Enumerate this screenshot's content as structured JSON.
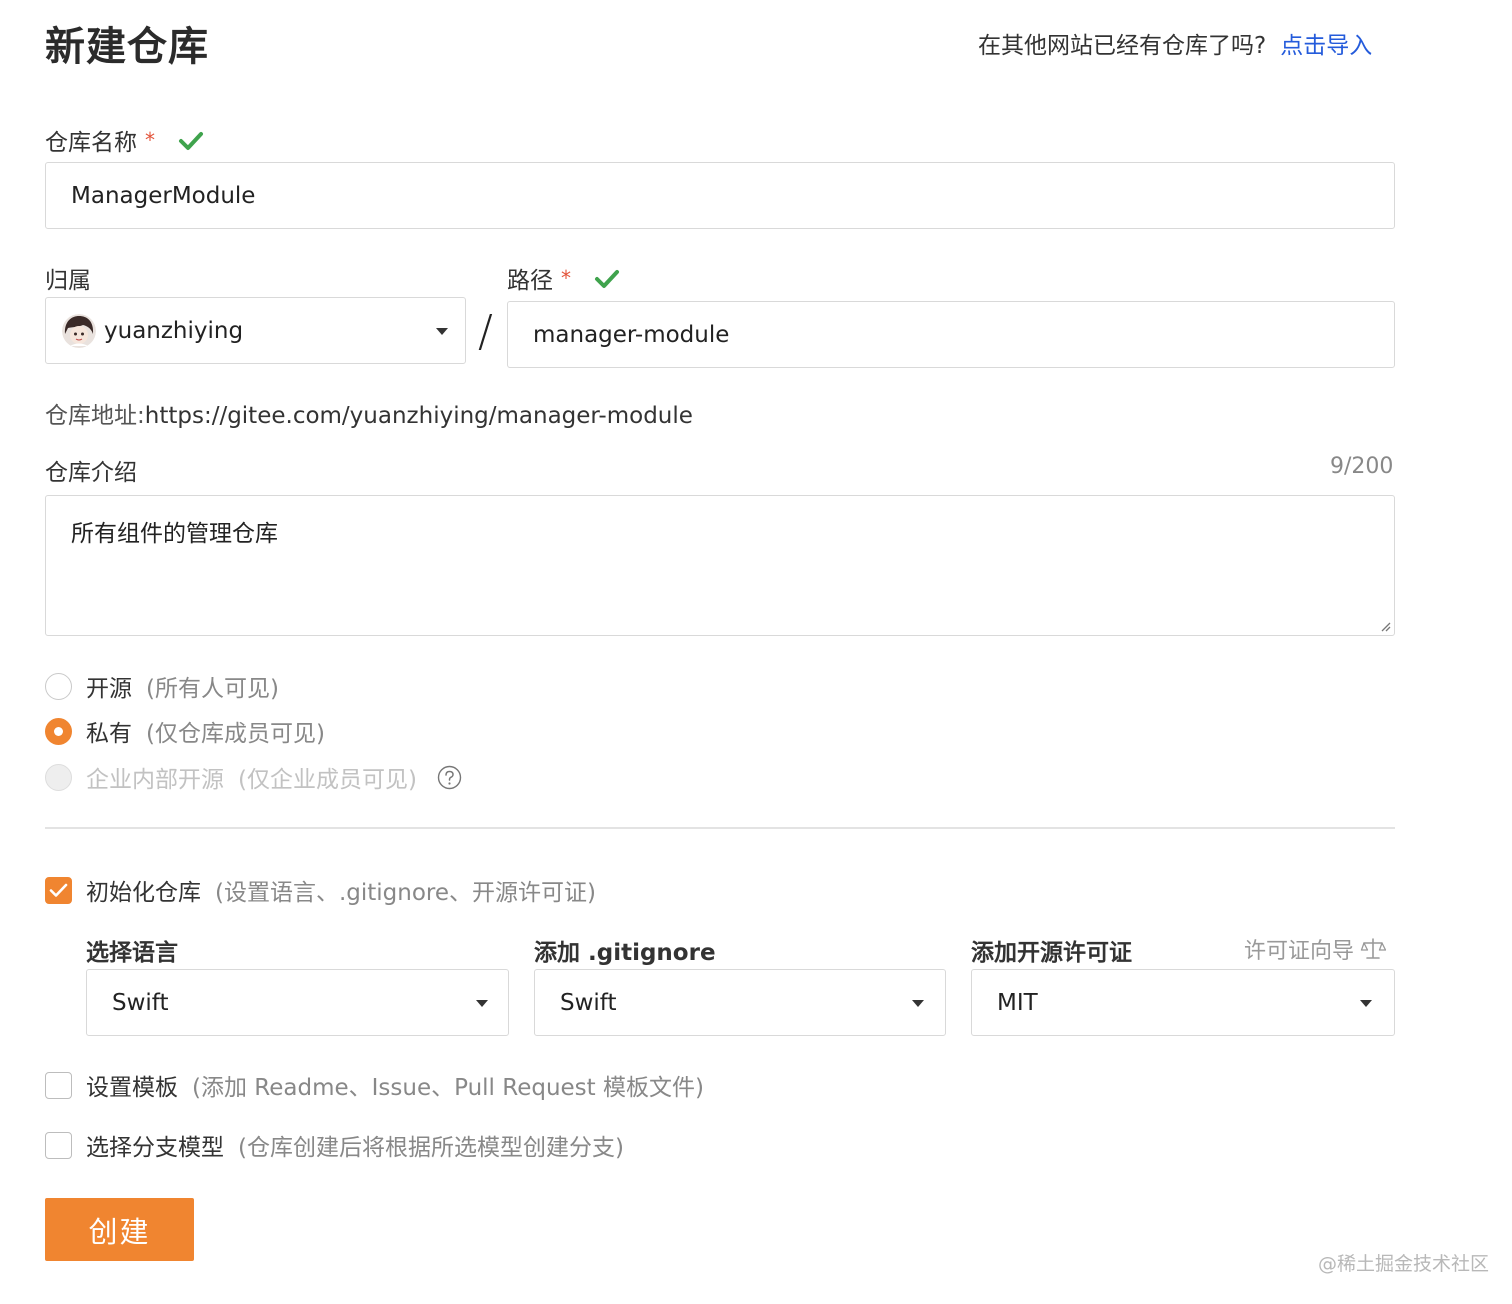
{
  "header": {
    "title": "新建仓库",
    "import_hint": "在其他网站已经有仓库了吗?",
    "import_link": "点击导入"
  },
  "repo_name": {
    "label": "仓库名称",
    "required_mark": "*",
    "value": "ManagerModule"
  },
  "owner": {
    "label": "归属",
    "value": "yuanzhiying"
  },
  "path": {
    "label": "路径",
    "required_mark": "*",
    "separator": "/",
    "value": "manager-module"
  },
  "address": {
    "label": "仓库地址:",
    "url": "https://gitee.com/yuanzhiying/manager-module"
  },
  "description": {
    "label": "仓库介绍",
    "counter": "9/200",
    "value": "所有组件的管理仓库"
  },
  "visibility": {
    "options": [
      {
        "label": "开源",
        "hint": "(所有人可见)",
        "checked": false,
        "disabled": false
      },
      {
        "label": "私有",
        "hint": "(仅仓库成员可见)",
        "checked": true,
        "disabled": false
      },
      {
        "label": "企业内部开源",
        "hint": "(仅企业成员可见)",
        "checked": false,
        "disabled": true
      }
    ]
  },
  "init_repo": {
    "label": "初始化仓库",
    "hint": "(设置语言、.gitignore、开源许可证)",
    "checked": true,
    "language": {
      "label": "选择语言",
      "value": "Swift"
    },
    "gitignore": {
      "label": "添加 .gitignore",
      "value": "Swift"
    },
    "license": {
      "label": "添加开源许可证",
      "guide": "许可证向导",
      "value": "MIT"
    }
  },
  "template": {
    "label": "设置模板",
    "hint": "(添加 Readme、Issue、Pull Request 模板文件)",
    "checked": false
  },
  "branch_model": {
    "label": "选择分支模型",
    "hint": "(仓库创建后将根据所选模型创建分支)",
    "checked": false
  },
  "submit": {
    "label": "创建"
  },
  "watermark": "@稀土掘金技术社区",
  "colors": {
    "accent": "#f08530",
    "link": "#245bdb",
    "valid": "#3fa34d"
  }
}
